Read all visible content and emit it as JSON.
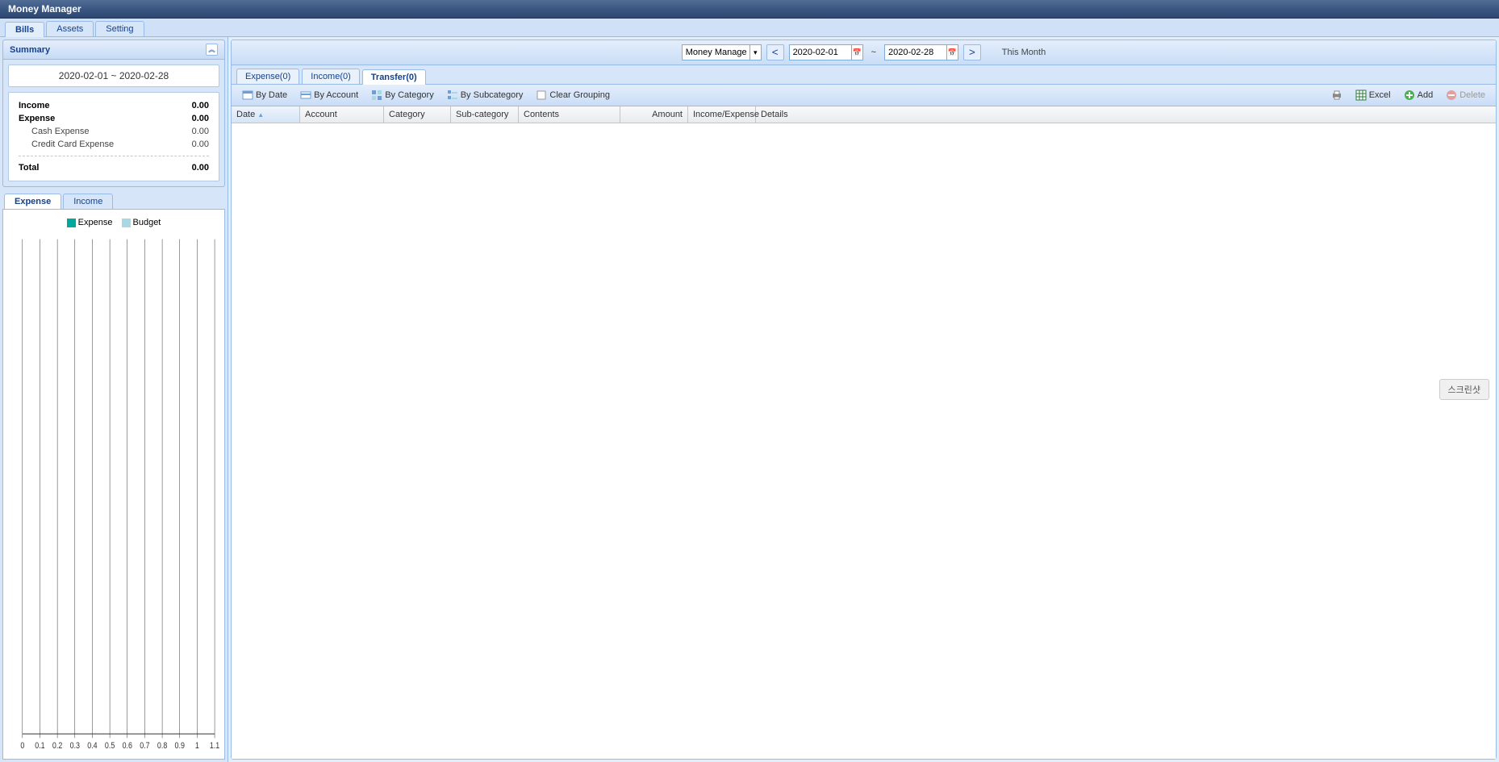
{
  "app": {
    "title": "Money Manager"
  },
  "main_tabs": {
    "bills": "Bills",
    "assets": "Assets",
    "setting": "Setting"
  },
  "summary": {
    "header": "Summary",
    "date_range": "2020-02-01  ~  2020-02-28",
    "rows": {
      "income_label": "Income",
      "income_value": "0.00",
      "expense_label": "Expense",
      "expense_value": "0.00",
      "cash_label": "Cash Expense",
      "cash_value": "0.00",
      "credit_label": "Credit Card Expense",
      "credit_value": "0.00",
      "total_label": "Total",
      "total_value": "0.00"
    }
  },
  "chart_tabs": {
    "expense": "Expense",
    "income": "Income"
  },
  "legend": {
    "expense": "Expense",
    "budget": "Budget",
    "colors": {
      "expense": "#00a99d",
      "budget": "#a7d8e4"
    }
  },
  "filter": {
    "select_value": "Money Manager",
    "prev": "<",
    "next": ">",
    "date_from": "2020-02-01",
    "date_to": "2020-02-28",
    "tilde": "~",
    "this_month": "This Month"
  },
  "bills_tabs": {
    "expense": "Expense(0)",
    "income": "Income(0)",
    "transfer": "Transfer(0)"
  },
  "toolbar": {
    "by_date": "By Date",
    "by_account": "By Account",
    "by_category": "By Category",
    "by_subcategory": "By Subcategory",
    "clear_grouping": "Clear Grouping",
    "excel": "Excel",
    "add": "Add",
    "delete": "Delete"
  },
  "grid_columns": {
    "date": "Date",
    "account": "Account",
    "category": "Category",
    "sub_category": "Sub-category",
    "contents": "Contents",
    "amount": "Amount",
    "income_expense": "Income/Expense",
    "details": "Details"
  },
  "chart_data": {
    "type": "bar",
    "categories": [
      "0",
      "0.1",
      "0.2",
      "0.3",
      "0.4",
      "0.5",
      "0.6",
      "0.7",
      "0.8",
      "0.9",
      "1",
      "1.1"
    ],
    "series": [
      {
        "name": "Expense",
        "values": [
          0,
          0,
          0,
          0,
          0,
          0,
          0,
          0,
          0,
          0,
          0,
          0
        ]
      },
      {
        "name": "Budget",
        "values": [
          0,
          0,
          0,
          0,
          0,
          0,
          0,
          0,
          0,
          0,
          0,
          0
        ]
      }
    ],
    "xlabel": "",
    "ylabel": "",
    "ylim": [
      0,
      1
    ]
  },
  "floating": {
    "label": "스크린샷"
  }
}
